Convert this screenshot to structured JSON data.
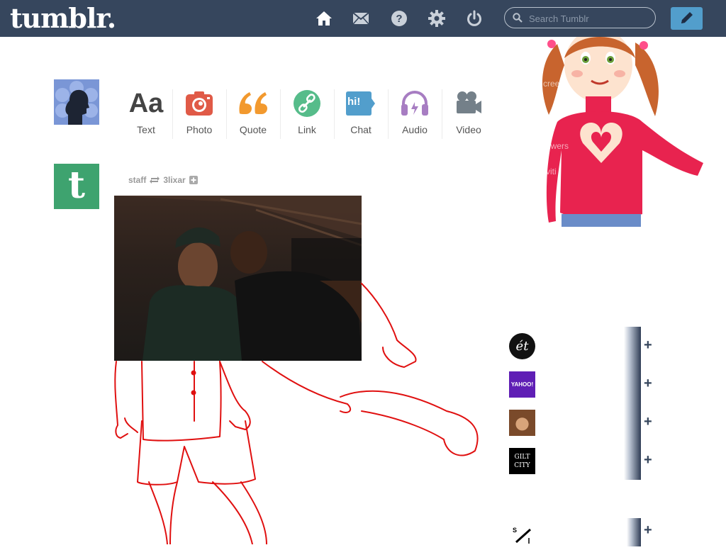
{
  "header": {
    "logo": "tumblr.",
    "search_placeholder": "Search Tumblr",
    "nav_icons": [
      "home-icon",
      "mail-icon",
      "help-icon",
      "gear-icon",
      "power-icon"
    ],
    "compose_icon": "pencil-icon",
    "colors": {
      "bar": "#36465d",
      "compose": "#529ecc"
    }
  },
  "post_types": [
    {
      "label": "Text",
      "icon": "text-aa-icon",
      "color": "#444444"
    },
    {
      "label": "Photo",
      "icon": "camera-icon",
      "color": "#e05a47"
    },
    {
      "label": "Quote",
      "icon": "quote-icon",
      "color": "#f2992e"
    },
    {
      "label": "Link",
      "icon": "link-icon",
      "color": "#56bc8a"
    },
    {
      "label": "Chat",
      "icon": "chat-icon",
      "color": "#529ecc"
    },
    {
      "label": "Audio",
      "icon": "headphones-icon",
      "color": "#a77dc2"
    },
    {
      "label": "Video",
      "icon": "video-camera-icon",
      "color": "#748089"
    }
  ],
  "text_icon_glyph": "Aa",
  "chat_icon_glyph": "hi!",
  "post": {
    "author": "staff",
    "reblogged_from": "3lixar",
    "avatar_letter": "t"
  },
  "recommended": [
    {
      "name": "et-logo",
      "avatar_text": "ét",
      "bg": "#111111"
    },
    {
      "name": "yahoo-logo",
      "avatar_text": "YAHOO!",
      "bg": "#5f1eb5"
    },
    {
      "name": "photo-avatar",
      "avatar_text": "",
      "bg": "#7a4a2a"
    },
    {
      "name": "gilt-city-logo",
      "avatar_text": "GILT CITY",
      "bg": "#000000"
    },
    {
      "name": "sketch-logo",
      "avatar_text": "",
      "bg": "#ffffff"
    }
  ]
}
